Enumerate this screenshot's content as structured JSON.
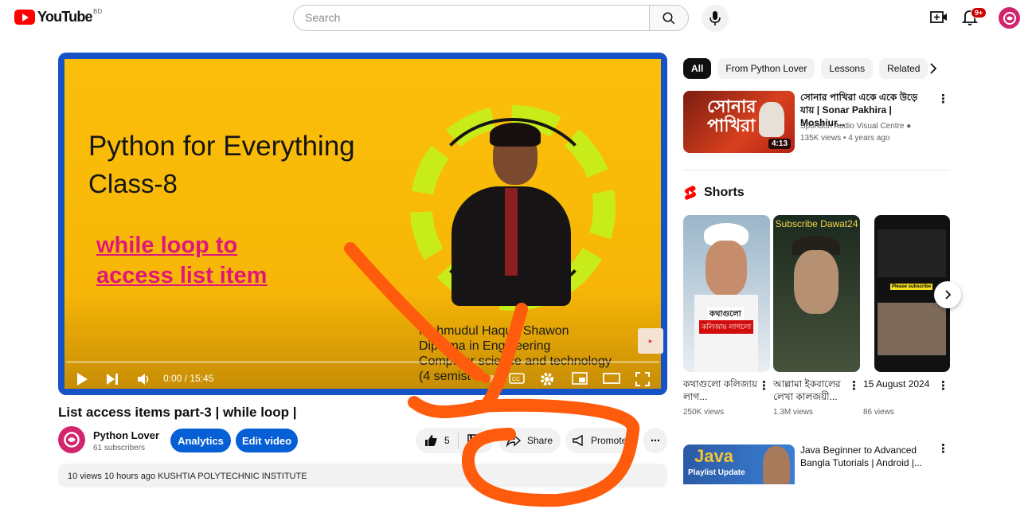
{
  "header": {
    "logo_text": "YouTube",
    "country_code": "BD",
    "search_placeholder": "Search",
    "notifications_badge": "9+",
    "icons": [
      "search-icon",
      "mic-icon",
      "create-icon",
      "bell-icon",
      "avatar"
    ]
  },
  "player": {
    "frame_title_line1": "Python for Everything",
    "frame_title_line2": "Class-8",
    "frame_sub_line1": "while loop to",
    "frame_sub_line2": "access  list item",
    "frame_credit_line1": "Mahmudul Haque Shawon",
    "frame_credit_line2": "Diploma in Engineering",
    "frame_credit_line3": "Computer science and technology",
    "frame_credit_line4": "(4 semist",
    "time": "0:00 / 15:45",
    "progress_fraction": 0
  },
  "video": {
    "title": "List access items part-3 | while loop |",
    "channel_name": "Python Lover",
    "channel_subs": "61 subscribers",
    "analytics_label": "Analytics",
    "edit_label": "Edit video",
    "likes": "5",
    "share_label": "Share",
    "promote_label": "Promote",
    "description_peek": "10 views  10 hours ago  KUSHTIA POLYTECHNIC INSTITUTE"
  },
  "sidebar": {
    "chips": [
      "All",
      "From Python Lover",
      "Lessons",
      "Related"
    ],
    "rec1": {
      "title": "সোনার পাখিরা একে একে উড়ে যায় | Sonar Pakhira | Moshiur...",
      "channel": "Spondon Audio Visual Centre",
      "meta": "135K views • 4 years ago",
      "duration": "4:13",
      "thumb_text": "সোনার পাখিরা"
    },
    "shorts_label": "Shorts",
    "shorts": [
      {
        "title": "কথাগুলো কলিজায় লাগ...",
        "views": "250K views",
        "overlay1": "কথাগুলো",
        "overlay2": "কলিজায় লাগলো"
      },
      {
        "title": "আল্লামা ইকবালের লেখা কালজয়ী...",
        "views": "1.3M views",
        "overlay1": "Subscribe Dawat24"
      },
      {
        "title": "15 August 2024",
        "views": "86 views",
        "overlay1": "Please subscribe"
      }
    ],
    "rec2": {
      "title": "Java Beginner to Advanced Bangla Tutorials | Android |...",
      "thumb_text": "Java",
      "thumb_sub": "Playlist Update"
    }
  }
}
